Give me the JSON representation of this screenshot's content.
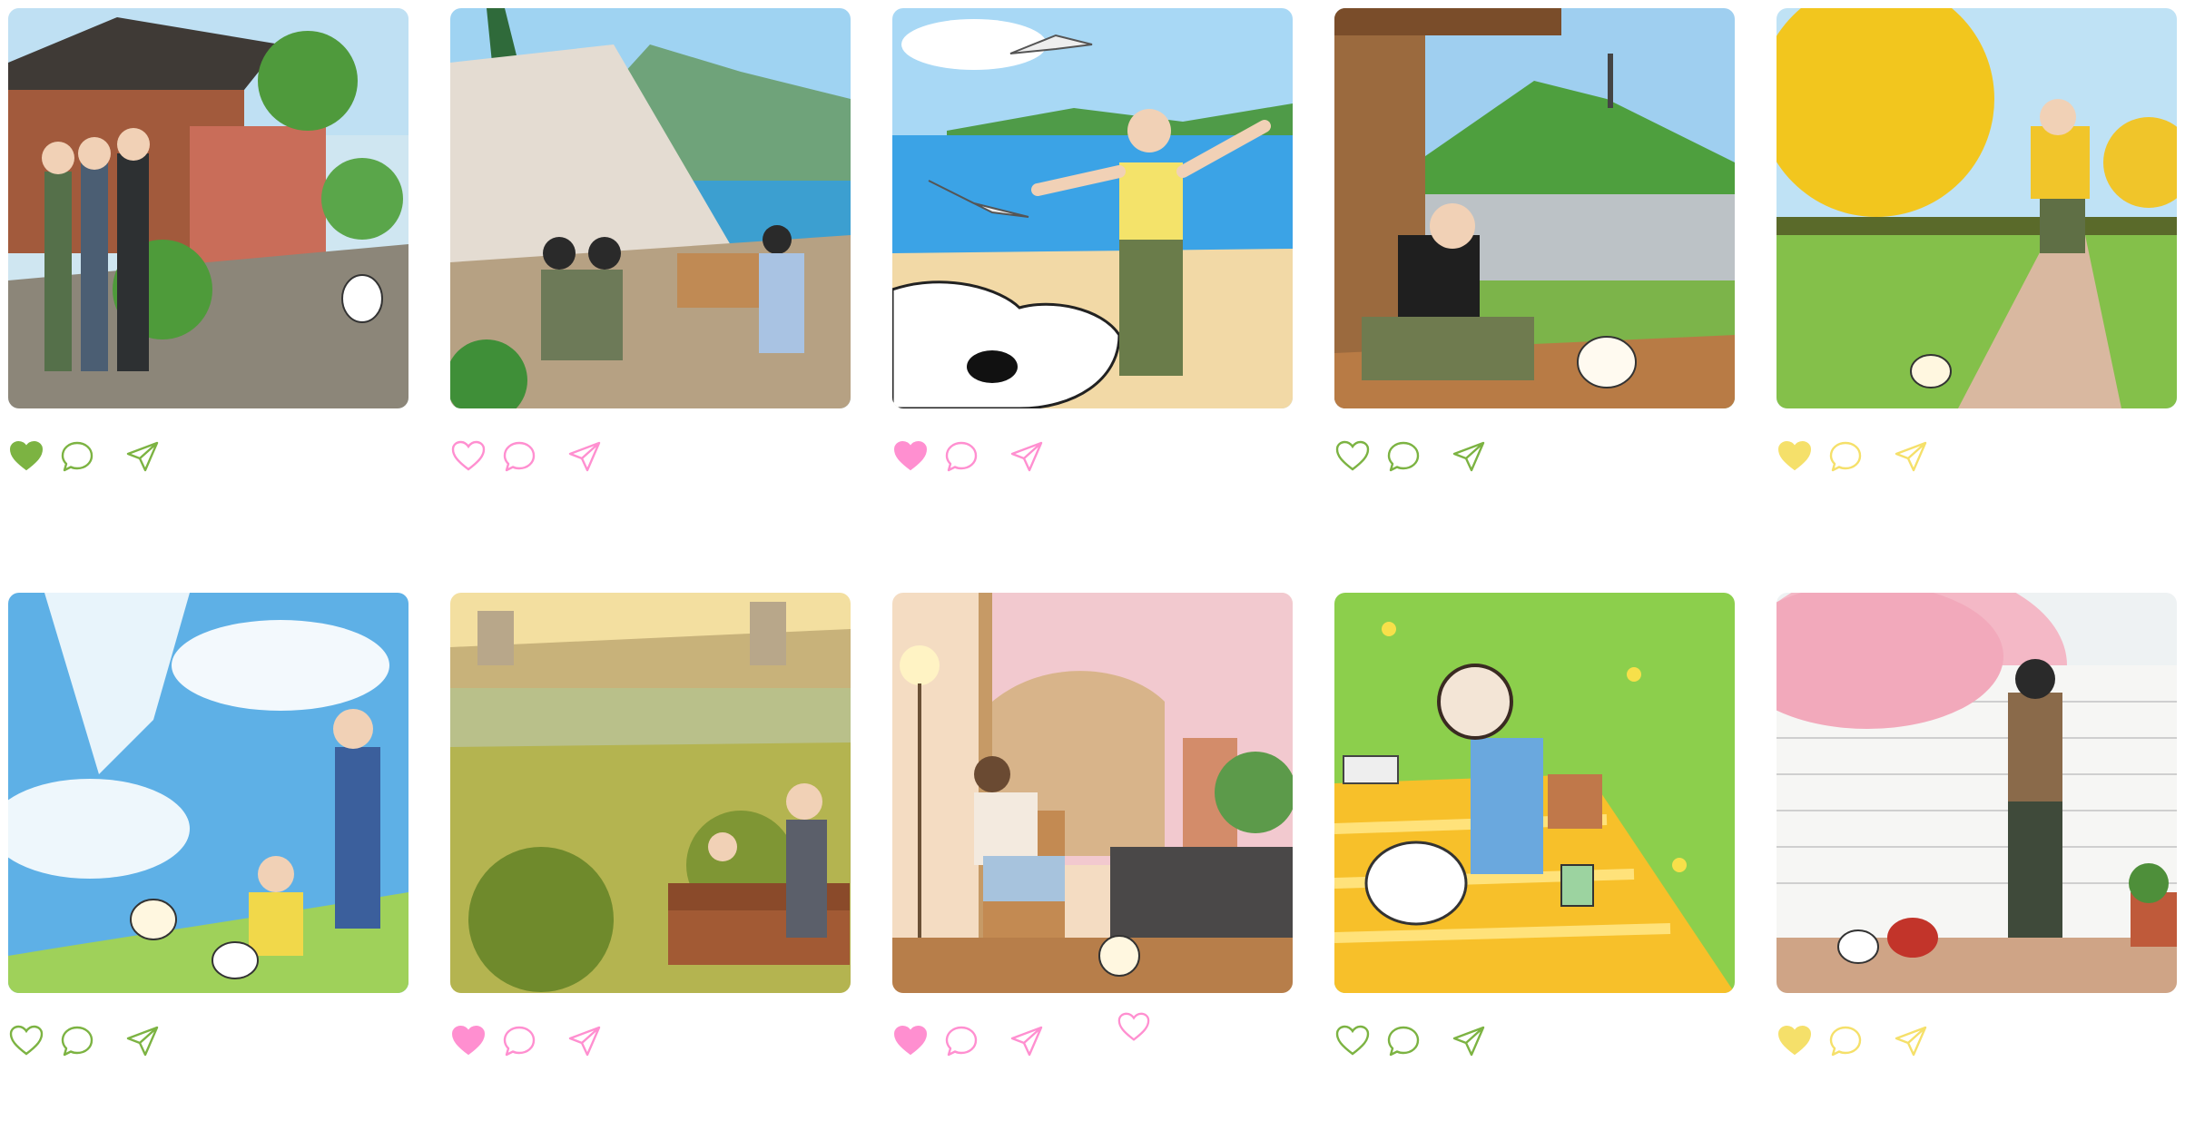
{
  "posts": [
    {
      "scene": "hanok-village",
      "liked": true,
      "accent": "#7cb342"
    },
    {
      "scene": "lakeside-camping",
      "liked": false,
      "accent": "#ff8fd0"
    },
    {
      "scene": "beach-seagulls",
      "liked": true,
      "accent": "#ff8fd0"
    },
    {
      "scene": "hanok-namsan-tower",
      "liked": false,
      "accent": "#7cb342"
    },
    {
      "scene": "ginkgo-path",
      "liked": true,
      "accent": "#f5e06a"
    },
    {
      "scene": "sky-clouds",
      "liked": false,
      "accent": "#7cb342"
    },
    {
      "scene": "riverside-field",
      "liked": true,
      "accent": "#ff8fd0"
    },
    {
      "scene": "colosseum-window",
      "liked": true,
      "accent": "#ff8fd0"
    },
    {
      "scene": "picnic-meadow",
      "liked": false,
      "accent": "#7cb342"
    },
    {
      "scene": "cherry-blossom-walk",
      "liked": true,
      "accent": "#f5e06a"
    }
  ],
  "icons": {
    "like": "heart-icon",
    "comment": "comment-bubble-icon",
    "share": "send-icon"
  },
  "extra": {
    "icon": "heart-icon",
    "accent": "#ff8fd0"
  }
}
